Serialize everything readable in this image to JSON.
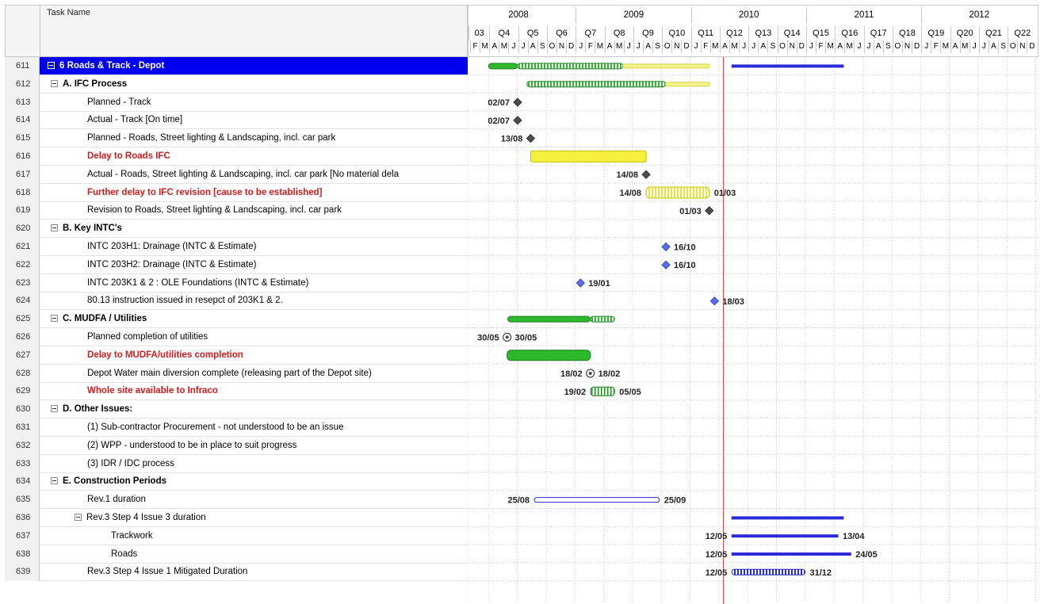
{
  "grid": {
    "header_label": "Task Name",
    "rows": [
      {
        "id": "611",
        "name": "6 Roads & Track - Depot",
        "indent": 0,
        "style": "sel",
        "expander": true
      },
      {
        "id": "612",
        "name": "A. IFC Process",
        "indent": 1,
        "style": "bold",
        "expander": true
      },
      {
        "id": "613",
        "name": "Planned - Track",
        "indent": 2,
        "style": "normal",
        "expander": false
      },
      {
        "id": "614",
        "name": "Actual - Track [On time]",
        "indent": 2,
        "style": "normal",
        "expander": false
      },
      {
        "id": "615",
        "name": "Planned - Roads, Street lighting & Landscaping, incl. car park",
        "indent": 2,
        "style": "normal",
        "expander": false
      },
      {
        "id": "616",
        "name": "Delay to Roads IFC",
        "indent": 2,
        "style": "red",
        "expander": false
      },
      {
        "id": "617",
        "name": "Actual - Roads, Street lighting & Landscaping, incl. car park [No material dela",
        "indent": 2,
        "style": "normal",
        "expander": false
      },
      {
        "id": "618",
        "name": "Further delay to IFC revision [cause to be established]",
        "indent": 2,
        "style": "red",
        "expander": false
      },
      {
        "id": "619",
        "name": "Revision to Roads, Street lighting & Landscaping, incl. car park",
        "indent": 2,
        "style": "normal",
        "expander": false
      },
      {
        "id": "620",
        "name": "B. Key INTC's",
        "indent": 1,
        "style": "bold",
        "expander": true
      },
      {
        "id": "621",
        "name": "INTC 203H1: Drainage (INTC & Estimate)",
        "indent": 2,
        "style": "normal",
        "expander": false
      },
      {
        "id": "622",
        "name": "INTC 203H2: Drainage (INTC & Estimate)",
        "indent": 2,
        "style": "normal",
        "expander": false
      },
      {
        "id": "623",
        "name": "INTC 203K1 & 2 : OLE Foundations (INTC & Estimate)",
        "indent": 2,
        "style": "normal",
        "expander": false
      },
      {
        "id": "624",
        "name": "80.13 instruction issued in resepct of 203K1 & 2.",
        "indent": 2,
        "style": "normal",
        "expander": false
      },
      {
        "id": "625",
        "name": "C. MUDFA / Utilities",
        "indent": 1,
        "style": "bold",
        "expander": true
      },
      {
        "id": "626",
        "name": "Planned completion of utilities",
        "indent": 2,
        "style": "normal",
        "expander": false
      },
      {
        "id": "627",
        "name": "Delay to MUDFA/utilities completion",
        "indent": 2,
        "style": "red",
        "expander": false
      },
      {
        "id": "628",
        "name": "Depot Water main diversion complete (releasing part of the Depot site)",
        "indent": 2,
        "style": "normal",
        "expander": false
      },
      {
        "id": "629",
        "name": "Whole site available to Infraco",
        "indent": 2,
        "style": "red",
        "expander": false
      },
      {
        "id": "630",
        "name": "D. Other Issues:",
        "indent": 1,
        "style": "bold",
        "expander": true
      },
      {
        "id": "631",
        "name": "(1) Sub-contractor Procurement - not understood to be an issue",
        "indent": 2,
        "style": "normal",
        "expander": false
      },
      {
        "id": "632",
        "name": "(2) WPP - understood to be in place to suit progress",
        "indent": 2,
        "style": "normal",
        "expander": false
      },
      {
        "id": "633",
        "name": "(3) IDR / IDC process",
        "indent": 2,
        "style": "normal",
        "expander": false
      },
      {
        "id": "634",
        "name": "E. Construction Periods",
        "indent": 1,
        "style": "bold",
        "expander": true
      },
      {
        "id": "635",
        "name": "Rev.1 duration",
        "indent": 2,
        "style": "normal",
        "expander": false
      },
      {
        "id": "636",
        "name": "Rev.3 Step 4 Issue 3 duration",
        "indent": 2,
        "style": "normal",
        "expander": true
      },
      {
        "id": "637",
        "name": "Trackwork",
        "indent": 3,
        "style": "normal",
        "expander": false
      },
      {
        "id": "638",
        "name": "Roads",
        "indent": 3,
        "style": "normal",
        "expander": false
      },
      {
        "id": "639",
        "name": "Rev.3 Step 4 Issue 1 Mitigated Duration",
        "indent": 2,
        "style": "normal",
        "expander": false
      }
    ]
  },
  "timescale": {
    "years": [
      "2008",
      "2009",
      "2010",
      "2011",
      "2012"
    ],
    "quarters": [
      "Q3",
      "Q4",
      "Q5",
      "Q6",
      "Q7",
      "Q8",
      "Q9",
      "Q10",
      "Q11",
      "Q12",
      "Q13",
      "Q14",
      "Q15",
      "Q16",
      "Q17",
      "Q18",
      "Q19",
      "Q20",
      "Q21",
      "Q22"
    ],
    "quarter_first_label": "03",
    "months": "FMAMJJASONDJFMAMJJASONDJFMAMJJASONDJFMAMJJASONDJFMAMJJASOND"
  },
  "chart": {
    "status_date": "2010-04-15",
    "colors": {
      "green": "#2eb82e",
      "yellow": "#f5f03c",
      "blue": "#2a2ad6",
      "grey": "#4d4d4d",
      "diamond_blue": "#5b6ee6",
      "status_line": "#c0504d"
    },
    "items": [
      {
        "row": 0,
        "kind": "bar",
        "color": "green",
        "start": "2008-04-01",
        "end": "2008-07-01"
      },
      {
        "row": 0,
        "kind": "bar",
        "color": "green_hatch",
        "start": "2008-07-01",
        "end": "2009-06-01"
      },
      {
        "row": 0,
        "kind": "bar",
        "color": "yellow_thin",
        "start": "2009-06-01",
        "end": "2010-03-01"
      },
      {
        "row": 0,
        "kind": "bar",
        "color": "blue",
        "start": "2010-05-12",
        "end": "2011-04-30"
      },
      {
        "row": 1,
        "kind": "bar",
        "color": "green_hatch",
        "start": "2008-08-01",
        "end": "2009-10-15"
      },
      {
        "row": 1,
        "kind": "bar",
        "color": "yellow_thin",
        "start": "2009-10-15",
        "end": "2010-03-01"
      },
      {
        "row": 2,
        "kind": "diamond",
        "color": "grey",
        "date": "2008-07-02",
        "label_left": "02/07"
      },
      {
        "row": 3,
        "kind": "diamond",
        "color": "grey",
        "date": "2008-07-02",
        "label_left": "02/07"
      },
      {
        "row": 4,
        "kind": "diamond",
        "color": "grey",
        "date": "2008-08-13",
        "label_left": "13/08"
      },
      {
        "row": 5,
        "kind": "bar",
        "color": "yellow",
        "start": "2008-08-13",
        "end": "2009-08-14"
      },
      {
        "row": 6,
        "kind": "diamond",
        "color": "grey",
        "date": "2009-08-14",
        "label_left": "14/08"
      },
      {
        "row": 7,
        "kind": "bar",
        "color": "yellow_hatch",
        "start": "2009-08-14",
        "end": "2010-03-01",
        "label_left": "14/08",
        "label_right": "01/03"
      },
      {
        "row": 8,
        "kind": "diamond",
        "color": "grey",
        "date": "2010-03-01",
        "label_left": "01/03"
      },
      {
        "row": 10,
        "kind": "diamond",
        "color": "diamond_blue",
        "date": "2009-10-16",
        "label_right": "16/10"
      },
      {
        "row": 11,
        "kind": "diamond",
        "color": "diamond_blue",
        "date": "2009-10-16",
        "label_right": "16/10"
      },
      {
        "row": 12,
        "kind": "diamond",
        "color": "diamond_blue",
        "date": "2009-01-19",
        "label_right": "19/01"
      },
      {
        "row": 13,
        "kind": "diamond",
        "color": "diamond_blue",
        "date": "2010-03-18",
        "label_right": "18/03"
      },
      {
        "row": 14,
        "kind": "bar",
        "color": "green",
        "start": "2008-06-01",
        "end": "2009-02-18"
      },
      {
        "row": 14,
        "kind": "bar",
        "color": "green_hatch",
        "start": "2009-02-18",
        "end": "2009-05-05"
      },
      {
        "row": 15,
        "kind": "circle",
        "date": "2008-05-30",
        "label_left": "30/05",
        "label_right": "30/05"
      },
      {
        "row": 16,
        "kind": "bar",
        "color": "green_thick",
        "start": "2008-05-30",
        "end": "2009-02-18"
      },
      {
        "row": 17,
        "kind": "circle",
        "date": "2009-02-18",
        "label_left": "18/02",
        "label_right": "18/02"
      },
      {
        "row": 18,
        "kind": "bar",
        "color": "green_stripes",
        "start": "2009-02-19",
        "end": "2009-05-05",
        "label_left": "19/02",
        "label_right": "05/05"
      },
      {
        "row": 24,
        "kind": "bar",
        "color": "blue_outline",
        "start": "2008-08-25",
        "end": "2009-09-25",
        "label_left": "25/08",
        "label_right": "25/09"
      },
      {
        "row": 25,
        "kind": "bar",
        "color": "blue",
        "start": "2010-05-12",
        "end": "2011-04-30"
      },
      {
        "row": 26,
        "kind": "bar",
        "color": "blue",
        "start": "2010-05-12",
        "end": "2011-04-13",
        "label_left": "12/05",
        "label_right": "13/04"
      },
      {
        "row": 27,
        "kind": "bar",
        "color": "blue",
        "start": "2010-05-12",
        "end": "2011-05-24",
        "label_left": "12/05",
        "label_right": "24/05"
      },
      {
        "row": 28,
        "kind": "bar",
        "color": "blue_hatch",
        "start": "2010-05-12",
        "end": "2010-12-31",
        "label_left": "12/05",
        "label_right": "31/12"
      }
    ]
  }
}
